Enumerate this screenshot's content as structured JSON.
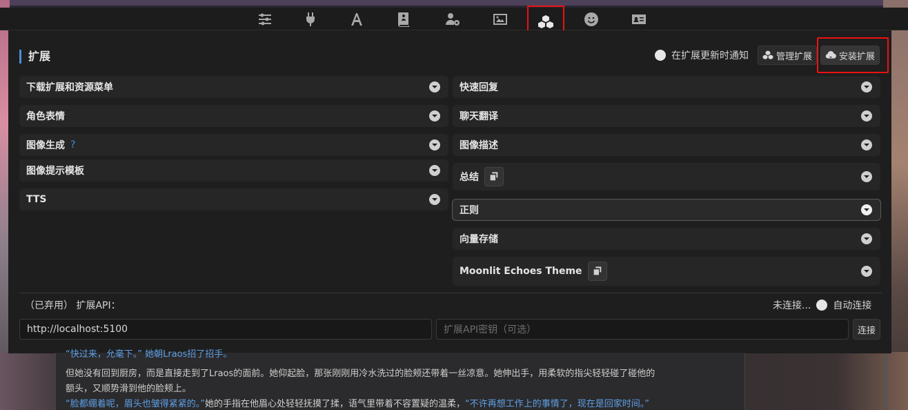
{
  "nav": {
    "icons": [
      "sliders-icon",
      "plug-icon",
      "font-icon",
      "book-icon",
      "user-gear-icon",
      "image-icon",
      "cubes-icon",
      "smile-icon",
      "id-card-icon"
    ]
  },
  "panel": {
    "title": "扩展",
    "notify_label": "在扩展更新时通知",
    "manage_label": "管理扩展",
    "install_label": "安装扩展"
  },
  "left_drawers": [
    {
      "label": "下载扩展和资源菜单"
    },
    {
      "label": "角色表情"
    },
    {
      "label": "图像生成",
      "help": "?"
    },
    {
      "label": "图像提示模板"
    },
    {
      "label": "TTS"
    }
  ],
  "right_drawers": [
    {
      "label": "快速回复"
    },
    {
      "label": "聊天翻译"
    },
    {
      "label": "图像描述"
    },
    {
      "label": "总结"
    },
    {
      "label": "正则"
    },
    {
      "label": "向量存储"
    },
    {
      "label": "Moonlit Echoes Theme"
    }
  ],
  "api": {
    "label": "（已弃用） 扩展API：",
    "status": "未连接...",
    "auto_connect": "自动连接",
    "url_value": "http://localhost:5100",
    "key_placeholder": "扩展API密钥（可选）",
    "connect_label": "连接"
  },
  "chat": {
    "line0": "“快过来，允毫下。” 她朝Lraos招了招手。",
    "line1": "但她没有回到厨房，而是直接走到了Lraos的面前。她仰起脸，那张刚刚用冷水洗过的脸颊还带着一丝凉意。她伸出手，用柔软的指尖轻轻碰了碰他的",
    "line2": "额头，又顺势滑到他的脸颊上。",
    "line3a": "“脸都绷着呢，眉头也皱得紧紧的。”",
    "line3b": "她的手指在他眉心处轻轻抚摸了揉，语气里带着不容置疑的温柔，",
    "line3c": "“不许再想工作上的事情了，现在是回家时间。”"
  },
  "colors": {
    "accent": "#4a90d9",
    "highlight": "#ee1111"
  }
}
